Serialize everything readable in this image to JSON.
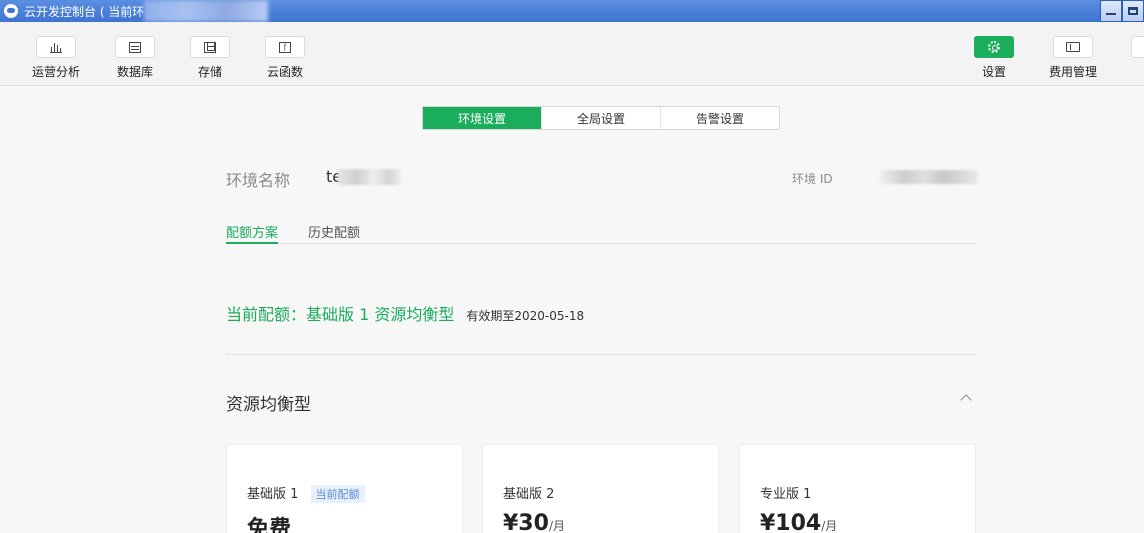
{
  "window": {
    "title": "云开发控制台 ( 当前环"
  },
  "toolbar": {
    "items": [
      {
        "label": "运营分析",
        "icon": "bar-chart-icon"
      },
      {
        "label": "数据库",
        "icon": "database-icon"
      },
      {
        "label": "存储",
        "icon": "storage-icon"
      },
      {
        "label": "云函数",
        "icon": "function-icon"
      }
    ],
    "right_items": [
      {
        "label": "设置",
        "icon": "gear-icon",
        "active": true
      },
      {
        "label": "费用管理",
        "icon": "card-icon"
      }
    ],
    "accent_color": "#1aad5c"
  },
  "tabs": [
    "环境设置",
    "全局设置",
    "告警设置"
  ],
  "env": {
    "name_label": "环境名称",
    "name_value": "te",
    "id_label": "环境 ID"
  },
  "subtabs": [
    "配额方案",
    "历史配额"
  ],
  "quota": {
    "current": "当前配额：基础版 1 资源均衡型",
    "expiry": "有效期至2020-05-18"
  },
  "section": {
    "title": "资源均衡型"
  },
  "plans": [
    {
      "name": "基础版 1",
      "badge": "当前配额",
      "price": "免费",
      "unit": ""
    },
    {
      "name": "基础版 2",
      "badge": "",
      "price": "¥30",
      "unit": "/月"
    },
    {
      "name": "专业版 1",
      "badge": "",
      "price": "¥104",
      "unit": "/月"
    }
  ]
}
